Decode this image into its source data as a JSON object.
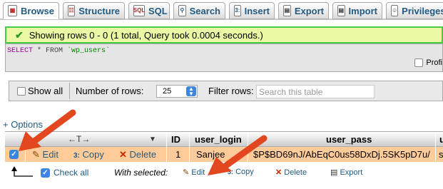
{
  "tabs": [
    {
      "label": "Browse",
      "icon": "browse-icon",
      "active": true
    },
    {
      "label": "Structure",
      "icon": "structure-icon"
    },
    {
      "label": "SQL",
      "icon": "sql-icon"
    },
    {
      "label": "Search",
      "icon": "search-icon"
    },
    {
      "label": "Insert",
      "icon": "insert-icon"
    },
    {
      "label": "Export",
      "icon": "export-icon"
    },
    {
      "label": "Import",
      "icon": "import-icon"
    },
    {
      "label": "Privileges",
      "icon": "privileges-icon"
    }
  ],
  "success": {
    "message": "Showing rows 0 - 0 (1 total, Query took 0.0004 seconds.)"
  },
  "sql": {
    "select": "SELECT",
    "rest": " * FROM ",
    "table": "`wp_users`",
    "profiling_label": "Profi"
  },
  "nav": {
    "show_all": "Show all",
    "rows_label": "Number of rows:",
    "rows_value": "25",
    "filter_label": "Filter rows:",
    "filter_placeholder": "Search this table"
  },
  "options_link": "+ Options",
  "table": {
    "arrows_symbol": "←T→",
    "sort_symbol": "▼",
    "headers": [
      "ID",
      "user_login",
      "user_pass",
      "u"
    ],
    "row": {
      "edit": "Edit",
      "copy": "Copy",
      "delete": "Delete",
      "id": "1",
      "user_login": "Sanjee",
      "user_pass": "$P$BD69nJ/AbEqC0us58DxDj.5SK5pD7u/",
      "extra": "s"
    }
  },
  "bulk": {
    "check_all": "Check all",
    "with_selected": "With selected:",
    "edit": "Edit",
    "copy": "Copy",
    "delete": "Delete",
    "export": "Export"
  },
  "colors": {
    "arrow": "#e2471f",
    "link": "#235a81",
    "success_bg": "#ebf8a4",
    "row_highlight": "#ffcc99"
  }
}
